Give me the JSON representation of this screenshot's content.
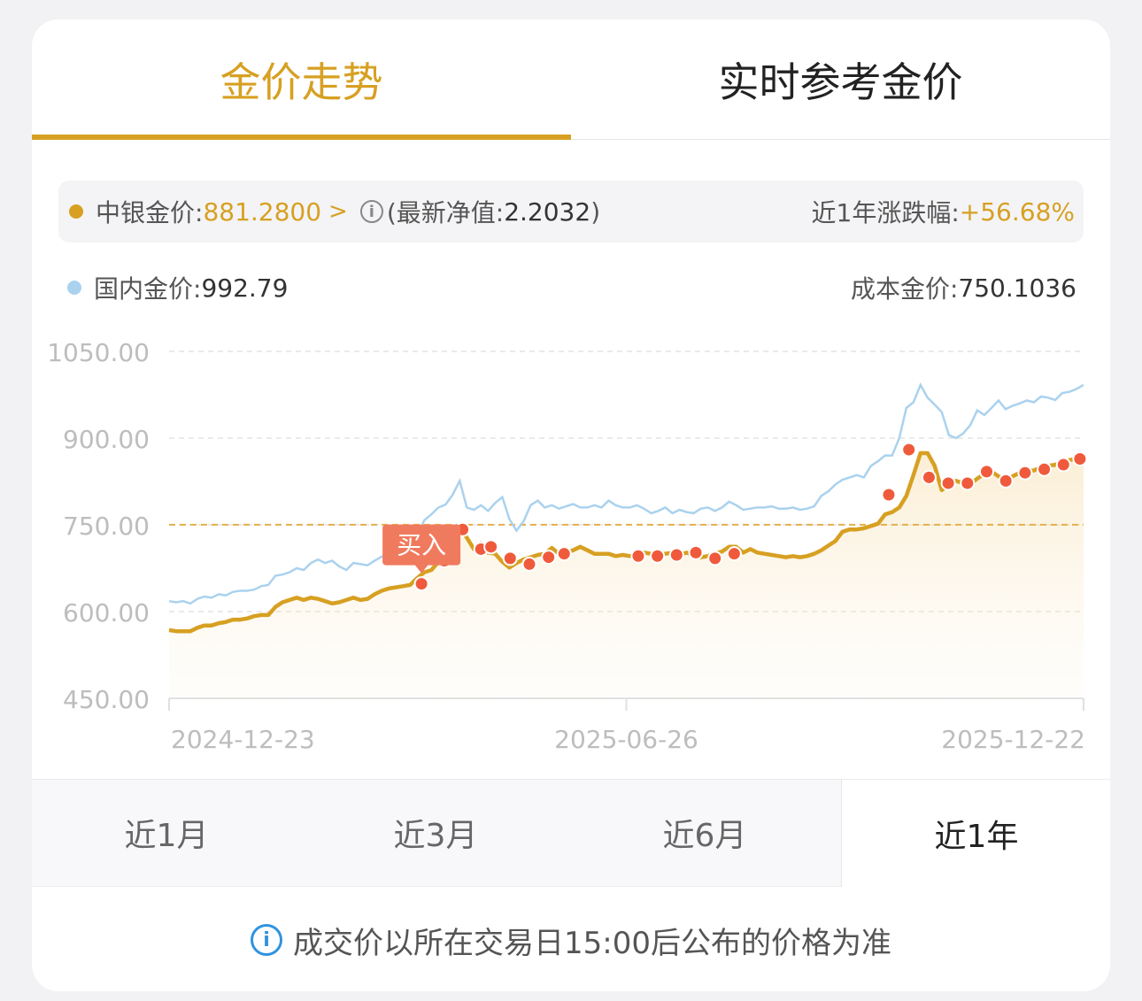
{
  "tabs": [
    {
      "label": "金价走势",
      "active": true
    },
    {
      "label": "实时参考金价",
      "active": false
    }
  ],
  "info": {
    "bank_gold_label": "中银金价:",
    "bank_gold_value": "881.2800",
    "nav_text": "(最新净值:",
    "nav_value": "2.2032",
    "nav_close": ")",
    "change_label": "近1年涨跌幅:",
    "change_value": "+56.68%",
    "domestic_label": "国内金价:",
    "domestic_value": "992.79",
    "cost_label": "成本金价:",
    "cost_value": "750.1036"
  },
  "colors": {
    "accent": "#d7a022",
    "domestic": "#aad2ee",
    "buy_marker": "#f05a3c",
    "buy_tag": "#f07a5e"
  },
  "periods": [
    {
      "label": "近1月",
      "active": false
    },
    {
      "label": "近3月",
      "active": false
    },
    {
      "label": "近6月",
      "active": false
    },
    {
      "label": "近1年",
      "active": true
    }
  ],
  "footer": {
    "text": "成交价以所在交易日15:00后公布的价格为准",
    "icon": "info-icon"
  },
  "chart_data": {
    "type": "line",
    "x_ticks": [
      "2024-12-23",
      "2025-06-26",
      "2025-12-22"
    ],
    "y_ticks": [
      "1050.00",
      "900.00",
      "750.00",
      "600.00",
      "450.00"
    ],
    "ylim": [
      450,
      1050
    ],
    "grid": true,
    "cost_line": 750.1036,
    "buy_label": "买入",
    "series": [
      {
        "values": [
          618,
          616,
          618,
          614,
          622,
          626,
          624,
          630,
          628,
          634,
          636,
          636,
          638,
          644,
          646,
          662,
          664,
          668,
          675,
          672,
          684,
          690,
          684,
          688,
          678,
          672,
          684,
          682,
          680,
          688,
          695,
          698,
          712,
          720,
          728,
          732,
          758,
          768,
          780,
          785,
          802,
          826,
          780,
          776,
          784,
          774,
          788,
          798,
          760,
          740,
          756,
          784,
          792,
          780,
          784,
          778,
          782,
          786,
          780,
          780,
          784,
          780,
          792,
          784,
          780,
          780,
          784,
          778,
          770,
          774,
          780,
          770,
          776,
          772,
          770,
          778,
          780,
          774,
          780,
          790,
          784,
          776,
          778,
          780,
          780,
          782,
          778,
          778,
          780,
          776,
          778,
          782,
          800,
          808,
          820,
          828,
          832,
          836,
          832,
          852,
          860,
          870,
          870,
          900,
          952,
          962,
          992,
          970,
          958,
          945,
          905,
          900,
          908,
          922,
          948,
          940,
          952,
          965,
          950,
          956,
          960,
          965,
          962,
          972,
          970,
          966,
          978,
          980,
          985,
          992
        ]
      },
      {
        "values": [
          568,
          566,
          566,
          566,
          572,
          576,
          576,
          580,
          582,
          586,
          586,
          588,
          592,
          594,
          594,
          608,
          616,
          620,
          624,
          620,
          624,
          622,
          618,
          614,
          616,
          620,
          624,
          620,
          622,
          630,
          636,
          640,
          642,
          644,
          646,
          658,
          668,
          672,
          686,
          700,
          722,
          742,
          728,
          708,
          718,
          702,
          700,
          686,
          676,
          684,
          690,
          694,
          698,
          700,
          710,
          700,
          702,
          706,
          712,
          706,
          700,
          700,
          700,
          696,
          698,
          696,
          698,
          702,
          700,
          700,
          700,
          702,
          698,
          702,
          698,
          694,
          696,
          700,
          704,
          712,
          712,
          702,
          708,
          702,
          700,
          698,
          696,
          694,
          696,
          694,
          696,
          700,
          706,
          714,
          722,
          738,
          742,
          742,
          744,
          748,
          752,
          768,
          772,
          780,
          800,
          836,
          874,
          874,
          852,
          810,
          820,
          826,
          822,
          820,
          830,
          838,
          842,
          834,
          826,
          834,
          840,
          844,
          844,
          850,
          852,
          854,
          860,
          862,
          864,
          870
        ]
      }
    ],
    "buy_points": [
      [
        0.276,
        648
      ],
      [
        0.301,
        688
      ],
      [
        0.321,
        742
      ],
      [
        0.341,
        708
      ],
      [
        0.352,
        712
      ],
      [
        0.373,
        692
      ],
      [
        0.394,
        682
      ],
      [
        0.415,
        694
      ],
      [
        0.432,
        700
      ],
      [
        0.513,
        696
      ],
      [
        0.534,
        696
      ],
      [
        0.555,
        698
      ],
      [
        0.576,
        702
      ],
      [
        0.597,
        692
      ],
      [
        0.618,
        700
      ],
      [
        0.787,
        802
      ],
      [
        0.809,
        880
      ],
      [
        0.831,
        832
      ],
      [
        0.852,
        822
      ],
      [
        0.873,
        822
      ],
      [
        0.894,
        842
      ],
      [
        0.915,
        826
      ],
      [
        0.936,
        840
      ],
      [
        0.957,
        846
      ],
      [
        0.978,
        854
      ],
      [
        0.996,
        864
      ]
    ]
  }
}
